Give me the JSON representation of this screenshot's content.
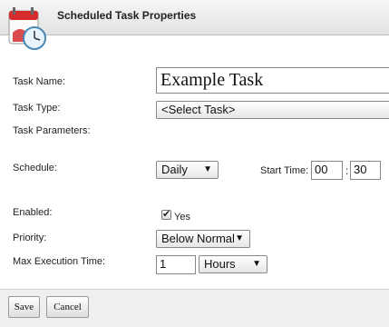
{
  "window": {
    "title": "Scheduled Task Properties",
    "icon": "calendar-clock-icon"
  },
  "form": {
    "task_name": {
      "label": "Task Name:",
      "value": "Example Task"
    },
    "task_type": {
      "label": "Task Type:",
      "selected": "<Select Task>"
    },
    "task_parameters": {
      "label": "Task Parameters:"
    },
    "schedule": {
      "label": "Schedule:",
      "frequency": "Daily",
      "start_time_label": "Start Time:",
      "hour": "00",
      "separator": ":",
      "minute": "30"
    },
    "enabled": {
      "label": "Enabled:",
      "checked": true,
      "option_label": "Yes"
    },
    "priority": {
      "label": "Priority:",
      "selected": "Below Normal"
    },
    "max_execution_time": {
      "label": "Max Execution Time:",
      "value": "1",
      "unit": "Hours"
    }
  },
  "footer": {
    "save_label": "Save",
    "cancel_label": "Cancel"
  },
  "icons": {
    "dropdown": "▼",
    "checkmark": "✔"
  }
}
